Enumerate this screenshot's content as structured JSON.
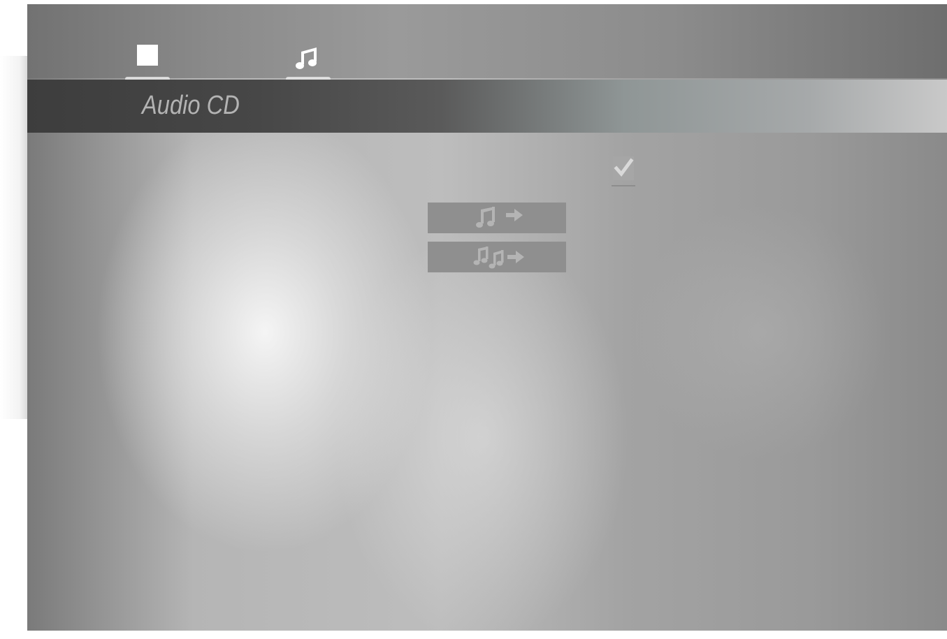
{
  "menu": {
    "title": "Audio CD",
    "tabs": [
      {
        "icon": "disc-square-icon",
        "selected": true
      },
      {
        "icon": "music-note-icon",
        "selected": false
      }
    ],
    "options": [
      {
        "icon": "music-note-arrow-icon"
      },
      {
        "icon": "music-notes-arrow-icon"
      }
    ],
    "checkbox_checked": true
  },
  "colors": {
    "band_dark": "#3d3d3d",
    "title_text": "#b3b3b3",
    "button_bg": "#8f8f8f",
    "icon_white": "#ffffff"
  }
}
